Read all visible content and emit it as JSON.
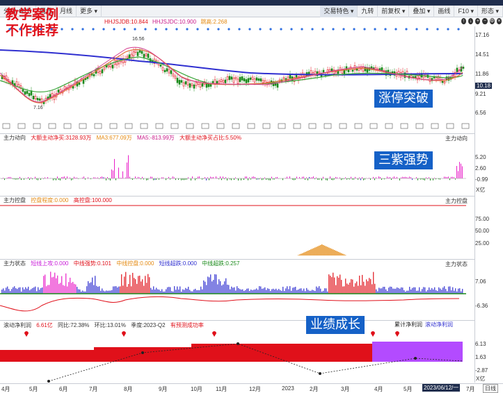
{
  "toolbar": {
    "items": [
      "分时",
      "60分",
      "周线",
      "月线",
      "更多 ▾"
    ],
    "right_items": [
      "交易特色 ▾",
      "九转",
      "前复权 ▾",
      "叠加 ▾",
      "画线",
      "F10 ▾",
      "形态 ▾"
    ]
  },
  "watermark": {
    "line1": "教学案例",
    "line2": "不作推荐"
  },
  "info": {
    "hhjsjdb": "HHJSJDB:10.844",
    "hhjsjdc": "HHJSJDC:10.900",
    "jump": "跳高:2.268"
  },
  "price_axis": [
    "17.16",
    "14.51",
    "11.86",
    "10.18",
    "9.21",
    "6.56"
  ],
  "price_labels": {
    "high": "16.56",
    "low": "7.16"
  },
  "overlays": {
    "breakout": "涨停突破",
    "purple": "三紫强势",
    "growth": "业绩成长"
  },
  "panel1": {
    "name": "主力动向",
    "big": "大额主动净买:3128.93万",
    "ma3": "MA3:677.09万",
    "ma5": "MA5:-813.99万",
    "ratio": "大额主动净买占比:5.50%",
    "right_label": "主力动向",
    "axis": [
      "5.20",
      "2.60",
      "-0.99"
    ],
    "unit": "X亿"
  },
  "panel2": {
    "name": "主力控盘",
    "degree": "控盘程度:0.000",
    "high": "高控盘:100.000",
    "right_label": "主力控盘",
    "axis": [
      "75.00",
      "50.00",
      "25.00"
    ]
  },
  "panel3": {
    "name": "主力状态",
    "short_up": "短线上攻:0.000",
    "mid_strong": "中线强势:0.101",
    "mid_ctrl": "中线控盘:0.000",
    "short_over": "短线超跌:0.000",
    "mid_over": "中线超跌:0.257",
    "right_label": "主力状态",
    "axis": [
      "7.06",
      "-6.36"
    ]
  },
  "panel4": {
    "name": "滚动净利润",
    "value": "6.61亿",
    "yoy": "同比:72.38%",
    "qoq": "环比:13.01%",
    "season": "季度:2023-Q2",
    "forecast": "有预测成功率",
    "legend1": "累计净利润",
    "legend2": "滚动净利润",
    "axis": [
      "6.13",
      "1.63",
      "-2.87"
    ],
    "unit": "X亿"
  },
  "xaxis": [
    "4月",
    "5月",
    "6月",
    "7月",
    "8月",
    "9月",
    "10月",
    "11月",
    "12月",
    "2023",
    "2月",
    "3月",
    "4月",
    "5月",
    "2023/06/12/一",
    "7月",
    "日线"
  ],
  "colors": {
    "accent": "#1561c7",
    "red": "#e0101a",
    "purple": "#b34bff"
  }
}
